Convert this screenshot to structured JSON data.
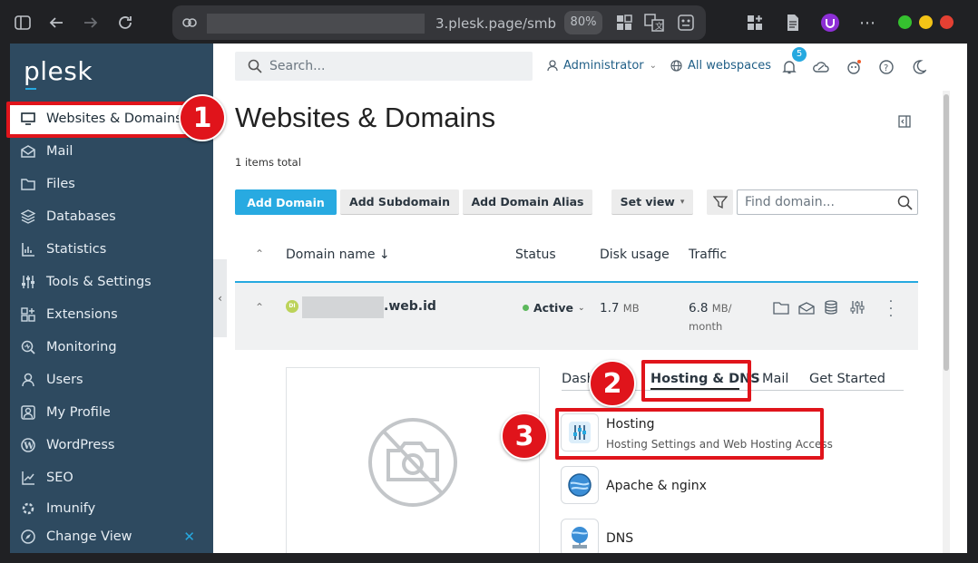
{
  "browser": {
    "url_suffix": "3.plesk.page/smb",
    "zoom": "80%"
  },
  "sidebar": {
    "logo": "plesk",
    "items": [
      {
        "label": "Websites & Domains",
        "icon": "monitor-icon"
      },
      {
        "label": "Mail",
        "icon": "mail-icon"
      },
      {
        "label": "Files",
        "icon": "folder-icon"
      },
      {
        "label": "Databases",
        "icon": "database-icon"
      },
      {
        "label": "Statistics",
        "icon": "bar-chart-icon"
      },
      {
        "label": "Tools & Settings",
        "icon": "sliders-icon"
      },
      {
        "label": "Extensions",
        "icon": "grid-icon"
      },
      {
        "label": "Monitoring",
        "icon": "monitoring-icon"
      },
      {
        "label": "Users",
        "icon": "user-icon"
      },
      {
        "label": "My Profile",
        "icon": "profile-icon"
      },
      {
        "label": "WordPress",
        "icon": "wordpress-icon"
      },
      {
        "label": "SEO",
        "icon": "seo-icon"
      },
      {
        "label": "Imunify",
        "icon": "imunify-icon"
      }
    ],
    "change_view": "Change View"
  },
  "header": {
    "search_placeholder": "Search...",
    "user": "Administrator",
    "webspaces": "All webspaces",
    "notifications_count": "5"
  },
  "page": {
    "title": "Websites & Domains",
    "items_total": "1 items total",
    "buttons": {
      "add_domain": "Add Domain",
      "add_subdomain": "Add Subdomain",
      "add_alias": "Add Domain Alias",
      "set_view": "Set view"
    },
    "find_placeholder": "Find domain...",
    "columns": {
      "domain": "Domain name ↓",
      "status": "Status",
      "disk": "Disk usage",
      "traffic": "Traffic"
    },
    "row": {
      "avatar": "DI",
      "domain_suffix": ".web.id",
      "status": "Active",
      "disk_value": "1.7",
      "disk_unit": "MB",
      "traffic_value": "6.8",
      "traffic_unit": "MB/",
      "traffic_period": "month"
    },
    "tabs": [
      "Dashboard",
      "Hosting & DNS",
      "Mail",
      "Get Started"
    ],
    "tab_visible_prefix": "Dash",
    "tools": [
      {
        "title": "Hosting",
        "desc": "Hosting Settings and Web Hosting Access"
      },
      {
        "title": "Apache & nginx",
        "desc": ""
      },
      {
        "title": "DNS",
        "desc": ""
      }
    ]
  },
  "annotations": [
    "1",
    "2",
    "3"
  ],
  "colors": {
    "sidebar": "#2e4a60",
    "accent": "#28aae1",
    "annotation": "#e0141b",
    "status_active": "#5cb85c"
  }
}
